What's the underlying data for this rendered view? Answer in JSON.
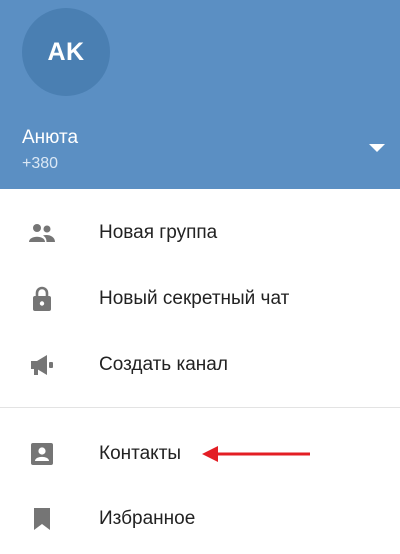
{
  "header": {
    "avatar_initials": "AK",
    "name": "Анюта",
    "phone": "+380",
    "color": "#5b8fc3"
  },
  "menu": {
    "items": [
      {
        "label": "Новая группа",
        "icon": "group-icon"
      },
      {
        "label": "Новый секретный чат",
        "icon": "lock-icon"
      },
      {
        "label": "Создать канал",
        "icon": "megaphone-icon"
      },
      {
        "label": "Контакты",
        "icon": "contact-card-icon"
      },
      {
        "label": "Избранное",
        "icon": "bookmark-icon"
      }
    ]
  },
  "annotation": {
    "arrow_color": "#e31e24",
    "arrow_target": "Контакты"
  }
}
